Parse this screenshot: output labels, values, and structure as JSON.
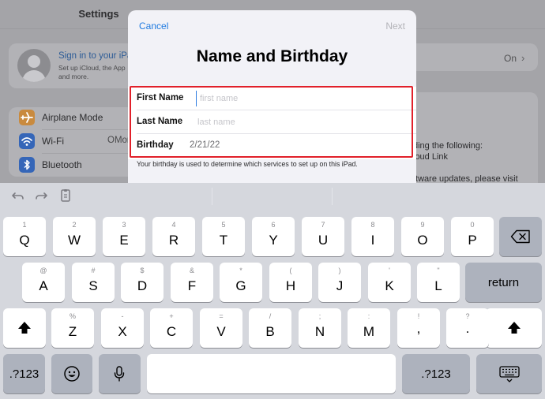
{
  "settings": {
    "title": "Settings",
    "account": {
      "signin_label": "Sign in to your iPad",
      "signin_subtitle_1": "Set up iCloud, the App",
      "signin_subtitle_2": "and more."
    },
    "right_value": "On",
    "rows": [
      {
        "label": "Airplane Mode",
        "value": ""
      },
      {
        "label": "Wi-Fi",
        "value": "OMon"
      },
      {
        "label": "Bluetooth",
        "value": ""
      }
    ],
    "right_panel_lines": [
      "ding the following:",
      "loud Link",
      "ftware updates, please visit"
    ]
  },
  "modal": {
    "cancel_label": "Cancel",
    "next_label": "Next",
    "title": "Name and Birthday",
    "first_name_label": "First Name",
    "first_name_placeholder": "first name",
    "first_name_value": "",
    "last_name_label": "Last Name",
    "last_name_placeholder": "last name",
    "last_name_value": "",
    "birthday_label": "Birthday",
    "birthday_value": "2/21/22",
    "caption": "Your birthday is used to determine which services to set up on this iPad."
  },
  "colors": {
    "accent": "#1f7ae0",
    "highlight": "#e1202a",
    "airplane": "#f09a37",
    "wifi": "#2f7bf6",
    "bluetooth": "#2f7bf6"
  },
  "icons": {
    "undo": "undo-icon",
    "redo": "redo-icon",
    "paste": "paste-icon",
    "shift": "shift-icon",
    "delete": "delete-icon",
    "emoji": "emoji-icon",
    "dictation": "microphone-icon",
    "dismiss": "keyboard-dismiss-icon"
  },
  "keyboard": {
    "row1": [
      {
        "sec": "1",
        "main": "Q"
      },
      {
        "sec": "2",
        "main": "W"
      },
      {
        "sec": "3",
        "main": "E"
      },
      {
        "sec": "4",
        "main": "R"
      },
      {
        "sec": "5",
        "main": "T"
      },
      {
        "sec": "6",
        "main": "Y"
      },
      {
        "sec": "7",
        "main": "U"
      },
      {
        "sec": "8",
        "main": "I"
      },
      {
        "sec": "9",
        "main": "O"
      },
      {
        "sec": "0",
        "main": "P"
      }
    ],
    "row2": [
      {
        "sec": "@",
        "main": "A"
      },
      {
        "sec": "#",
        "main": "S"
      },
      {
        "sec": "$",
        "main": "D"
      },
      {
        "sec": "&",
        "main": "F"
      },
      {
        "sec": "*",
        "main": "G"
      },
      {
        "sec": "(",
        "main": "H"
      },
      {
        "sec": ")",
        "main": "J"
      },
      {
        "sec": "'",
        "main": "K"
      },
      {
        "sec": "\"",
        "main": "L"
      }
    ],
    "row3": [
      {
        "sec": "%",
        "main": "Z"
      },
      {
        "sec": "-",
        "main": "X"
      },
      {
        "sec": "+",
        "main": "C"
      },
      {
        "sec": "=",
        "main": "V"
      },
      {
        "sec": "/",
        "main": "B"
      },
      {
        "sec": ";",
        "main": "N"
      },
      {
        "sec": ":",
        "main": "M"
      },
      {
        "sec": "!",
        "main": ","
      },
      {
        "sec": "?",
        "main": "."
      }
    ],
    "return_label": "return",
    "numbers_label": ".?123"
  }
}
